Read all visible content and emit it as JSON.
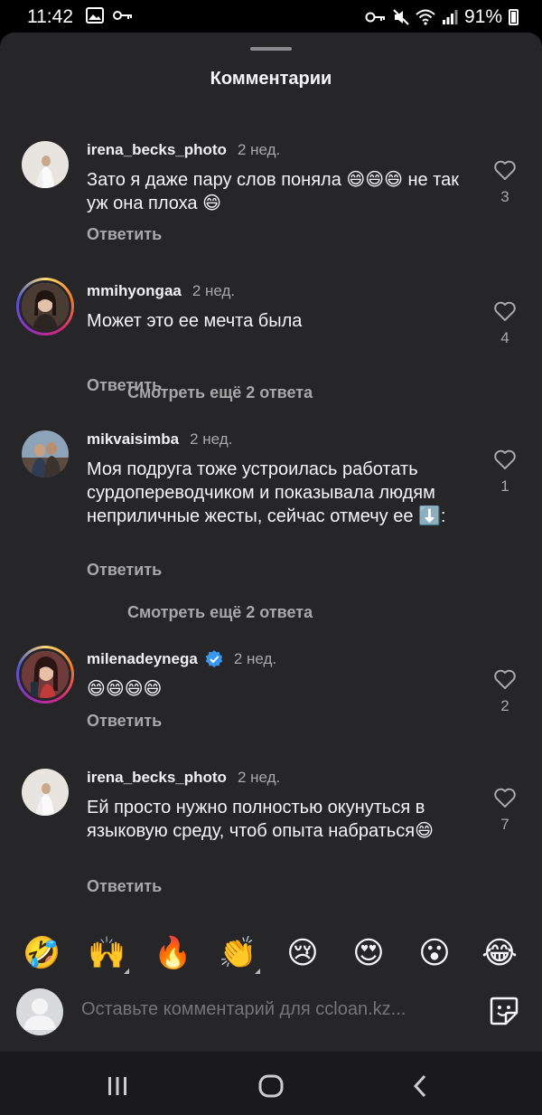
{
  "status_bar": {
    "time": "11:42",
    "battery": "91%",
    "icons_left": [
      "image-icon",
      "key-icon"
    ],
    "icons_right": [
      "vpn-key-icon",
      "mute-icon",
      "wifi-icon",
      "signal-icon",
      "battery-icon"
    ]
  },
  "sheet": {
    "title": "Комментарии"
  },
  "comments": [
    {
      "username": "irena_becks_photo",
      "time": "2 нед.",
      "text": "Зато я даже пару слов поняла 😄😄😄 не так уж она плоха 😄",
      "reply_label": "Ответить",
      "likes": "3",
      "verified": false
    },
    {
      "username": "mmihyongaa",
      "time": "2 нед.",
      "text": "Может это ее мечта была",
      "reply_label": "Ответить",
      "likes": "4",
      "verified": false,
      "more_replies": "Смотреть ещё 2 ответа"
    },
    {
      "username": "mikvaisimba",
      "time": "2 нед.",
      "text": "Моя подруга тоже устроилась работать сурдопереводчиком и показывала людям неприличные жесты, сейчас отмечу ее ⬇️:",
      "reply_label": "Ответить",
      "likes": "1",
      "verified": false,
      "more_replies": "Смотреть ещё 2 ответа"
    },
    {
      "username": "milenadeynega",
      "time": "2 нед.",
      "text": "😄😄😄😄",
      "reply_label": "Ответить",
      "likes": "2",
      "verified": true
    },
    {
      "username": "irena_becks_photo",
      "time": "2 нед.",
      "text": "Ей просто нужно полностью окунуться в языковую среду, чтоб опыта набраться😄",
      "reply_label": "Ответить",
      "likes": "7",
      "verified": false
    }
  ],
  "reactions": [
    "🤣",
    "🙌",
    "🔥",
    "👏",
    "😢",
    "😍",
    "😮",
    "😂"
  ],
  "input": {
    "placeholder": "Оставьте комментарий для ccloan.kz..."
  },
  "navbar": {
    "buttons": [
      "recent-apps",
      "home",
      "back"
    ]
  },
  "colors": {
    "background": "#262629",
    "text": "#f5f5f5",
    "secondary_text": "#a8a8a8",
    "verified_blue": "#3897f0",
    "navbar": "#1a1a1d"
  }
}
